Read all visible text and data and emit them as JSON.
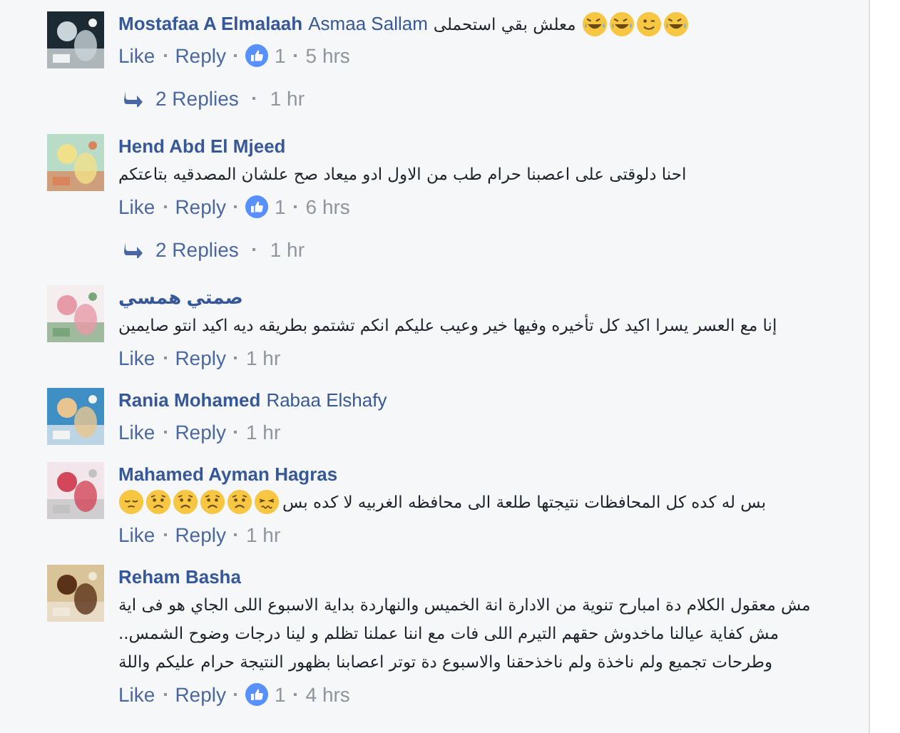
{
  "comments": [
    {
      "author": "Mostafaa A Elmalaah",
      "mention": "Asmaa Sallam",
      "lines": [
        "معلش بقي استحملى"
      ],
      "emojis": [
        {
          "kind": "laughing"
        },
        {
          "kind": "laughing"
        },
        {
          "kind": "winking"
        },
        {
          "kind": "laughing"
        }
      ],
      "actions": [
        "Like",
        "Reply"
      ],
      "likes": "1",
      "time": "5 hrs",
      "replies": {
        "label": "2 Replies",
        "time": "1 hr"
      }
    },
    {
      "author": "Hend Abd El Mjeed",
      "lines": [
        "احنا دلوقتى على اعصبنا حرام طب من الاول ادو ميعاد صح علشان المصدقيه بتاعتكم"
      ],
      "actions": [
        "Like",
        "Reply"
      ],
      "likes": "1",
      "time": "6 hrs",
      "replies": {
        "label": "2 Replies",
        "time": "1 hr"
      }
    },
    {
      "author": "صمتي همسي",
      "lines": [
        "إنا مع العسر يسرا اكيد كل تأخيره وفيها خير وعيب عليكم انكم تشتمو بطريقه ديه اكيد انتو صايمين"
      ],
      "actions": [
        "Like",
        "Reply"
      ],
      "time": "1 hr"
    },
    {
      "author": "Rania Mohamed",
      "mention": "Rabaa Elshafy",
      "actions": [
        "Like",
        "Reply"
      ],
      "time": "1 hr"
    },
    {
      "author": "Mahamed Ayman Hagras",
      "lines": [
        "بس له كده كل المحافظات نتيجتها طلعة الى محافظه الغربيه لا كده بس"
      ],
      "emojis": [
        {
          "kind": "tired"
        },
        {
          "kind": "worried"
        },
        {
          "kind": "worried"
        },
        {
          "kind": "worried"
        },
        {
          "kind": "worried"
        },
        {
          "kind": "sad"
        }
      ],
      "actions": [
        "Like",
        "Reply"
      ],
      "time": "1 hr"
    },
    {
      "author": "Reham Basha",
      "lines": [
        "مش معقول الكلام دة امبارح تنوية من الادارة انة الخميس والنهاردة بداية الاسبوع اللى الجاي هو فى اية",
        "مش كفاية عيالنا ماخدوش حقهم التيرم اللى فات مع اننا عملنا تظلم و لينا درجات وضوح الشمس..",
        "وطرحات تجميع ولم ناخذة ولم ناخذحقنا والاسبوع دة توتر اعصابنا بظهور النتيجة حرام عليكم واللة"
      ],
      "actions": [
        "Like",
        "Reply"
      ],
      "likes": "1",
      "time": "4 hrs"
    }
  ]
}
